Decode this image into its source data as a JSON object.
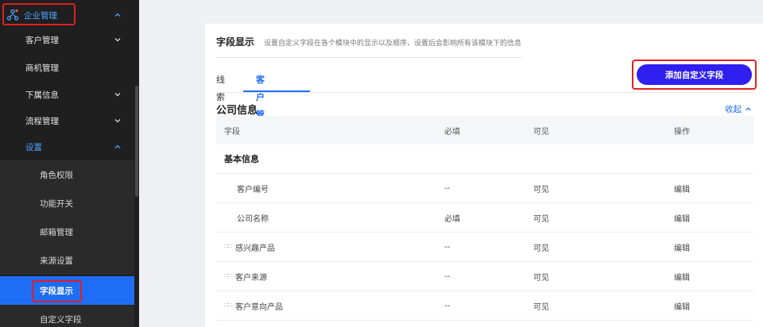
{
  "sidebar": {
    "top": {
      "label": "企业管理"
    },
    "groups": [
      {
        "label": "客户管理"
      },
      {
        "label": "商机管理"
      },
      {
        "label": "下属信息"
      },
      {
        "label": "流程管理"
      },
      {
        "label": "设置"
      }
    ],
    "settings_items": [
      {
        "label": "角色权限"
      },
      {
        "label": "功能开关"
      },
      {
        "label": "邮箱管理"
      },
      {
        "label": "来源设置"
      },
      {
        "label": "字段显示"
      },
      {
        "label": "自定义字段"
      }
    ]
  },
  "header": {
    "title": "字段显示",
    "description": "设置自定义字段在各个模块中的显示以及顺序，设置后会影响所有该模块下的信息"
  },
  "tabs": [
    {
      "label": "线索"
    },
    {
      "label": "客户管理"
    }
  ],
  "add_button": {
    "label": "添加自定义字段"
  },
  "section": {
    "title": "公司信息",
    "collapse_label": "收起"
  },
  "table": {
    "columns": {
      "field": "字段",
      "required": "必填",
      "visible": "可见",
      "action": "操作"
    },
    "group": "基本信息",
    "rows": [
      {
        "field": "客户编号",
        "required": "--",
        "visible": "可见",
        "action": "编辑"
      },
      {
        "field": "公司名称",
        "required": "必填",
        "visible": "可见",
        "action": "编辑"
      },
      {
        "field": "感兴趣产品",
        "required": "--",
        "visible": "可见",
        "action": "编辑"
      },
      {
        "field": "客户来源",
        "required": "--",
        "visible": "可见",
        "action": "编辑"
      },
      {
        "field": "客户意向产品",
        "required": "--",
        "visible": "可见",
        "action": "编辑"
      }
    ]
  },
  "colors": {
    "sidebar_bg": "#1f1f20",
    "accent_blue": "#1f6df5",
    "button_blue": "#2f1ff0",
    "highlight_red": "#e02020"
  }
}
